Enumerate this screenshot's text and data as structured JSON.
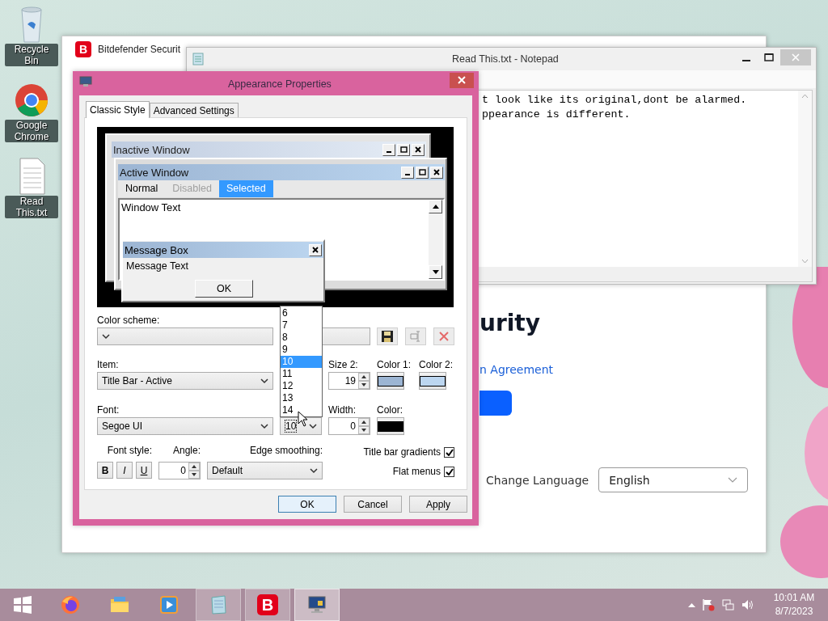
{
  "desktop_icons": [
    {
      "label": "Recycle Bin",
      "kind": "recycle"
    },
    {
      "label": "Google Chrome",
      "kind": "browser"
    },
    {
      "label": "Read This.txt",
      "kind": "text"
    }
  ],
  "bitdefender_window": {
    "logo": "B",
    "title": "Bitdefender Securit",
    "heading": "urity",
    "link": "n Agreement",
    "language_label": "Change Language",
    "language_value": "English"
  },
  "notepad_window": {
    "title": "Read This.txt - Notepad",
    "lines": [
      "t look like its original,dont be alarmed.",
      "ppearance is different."
    ]
  },
  "appearance_dialog": {
    "title": "Appearance Properties",
    "tabs": [
      {
        "label": "Classic Style",
        "selected": true
      },
      {
        "label": "Advanced Settings",
        "selected": false
      }
    ],
    "preview": {
      "inactive_title": "Inactive Window",
      "active_title": "Active Window",
      "menu": [
        {
          "label": "Normal",
          "kind": "normal"
        },
        {
          "label": "Disabled",
          "kind": "disabled"
        },
        {
          "label": "Selected",
          "kind": "selected"
        }
      ],
      "window_text": "Window Text",
      "message_title": "Message Box",
      "message_text": "Message Text",
      "message_button": "OK"
    },
    "color_scheme_label": "Color scheme:",
    "item": {
      "label": "Item:",
      "value": "Title Bar - Active"
    },
    "size2": {
      "label": "Size 2:",
      "value": "19"
    },
    "item_colors": [
      {
        "label": "Color 1:",
        "color": "#9cb5d3"
      },
      {
        "label": "Color 2:",
        "color": "#bcd6f0"
      }
    ],
    "font": {
      "label": "Font:",
      "value": "Segoe UI"
    },
    "font_size": {
      "value": "10",
      "options": [
        {
          "label": "6",
          "selected": false
        },
        {
          "label": "7",
          "selected": false
        },
        {
          "label": "8",
          "selected": false
        },
        {
          "label": "9",
          "selected": false
        },
        {
          "label": "10",
          "selected": true
        },
        {
          "label": "11",
          "selected": false
        },
        {
          "label": "12",
          "selected": false
        },
        {
          "label": "13",
          "selected": false
        },
        {
          "label": "14",
          "selected": false
        }
      ]
    },
    "width": {
      "label": "Width:",
      "value": "0"
    },
    "font_color": {
      "label": "Color:",
      "color": "#000000"
    },
    "font_style": {
      "label": "Font style:",
      "buttons": [
        "B",
        "I",
        "U"
      ]
    },
    "angle": {
      "label": "Angle:",
      "value": "0"
    },
    "edge_smoothing": {
      "label": "Edge smoothing:",
      "value": "Default"
    },
    "checkboxes": [
      {
        "label": "Title bar gradients",
        "checked": true
      },
      {
        "label": "Flat menus",
        "checked": true
      }
    ],
    "buttons": [
      "OK",
      "Cancel",
      "Apply"
    ]
  },
  "taskbar": {
    "apps": [
      {
        "kind": "firefox",
        "open": false,
        "selected": false
      },
      {
        "kind": "folder",
        "open": false,
        "selected": false
      },
      {
        "kind": "media",
        "open": false,
        "selected": false
      },
      {
        "kind": "notepad",
        "open": true,
        "selected": false
      },
      {
        "kind": "letter",
        "letter": "B",
        "open": true,
        "selected": false
      },
      {
        "kind": "monitor",
        "open": true,
        "selected": true
      }
    ],
    "time": "10:01 AM",
    "date": "8/7/2023"
  }
}
